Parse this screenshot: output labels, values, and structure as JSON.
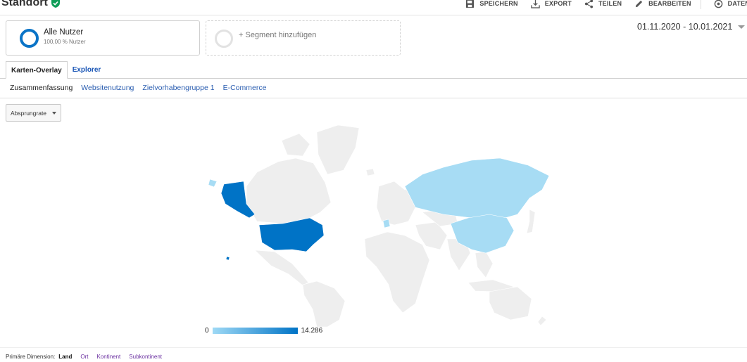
{
  "header": {
    "title": "Standort",
    "actions": {
      "save": "SPEICHERN",
      "export": "EXPORT",
      "share": "TEILEN",
      "edit": "BEARBEITEN",
      "data": "DATEN"
    }
  },
  "segments": {
    "primary": {
      "name": "Alle Nutzer",
      "sub": "100,00 % Nutzer"
    },
    "add": {
      "label": "+ Segment hinzufügen"
    }
  },
  "date_range": "01.11.2020 - 10.01.2021",
  "tabs": [
    "Karten-Overlay",
    "Explorer"
  ],
  "subtabs": [
    "Zusammenfassung",
    "Websitenutzung",
    "Zielvorhabengruppe 1",
    "E-Commerce"
  ],
  "metric_select": "Absprungrate",
  "map_legend": {
    "min": "0",
    "max": "14.286"
  },
  "colors": {
    "high": "#0073c6",
    "low": "#a7dcf4",
    "none": "#eeeeee"
  },
  "primary_dimension": {
    "label": "Primäre Dimension:",
    "current": "Land",
    "options": [
      "Ort",
      "Kontinent",
      "Subkontinent"
    ]
  }
}
